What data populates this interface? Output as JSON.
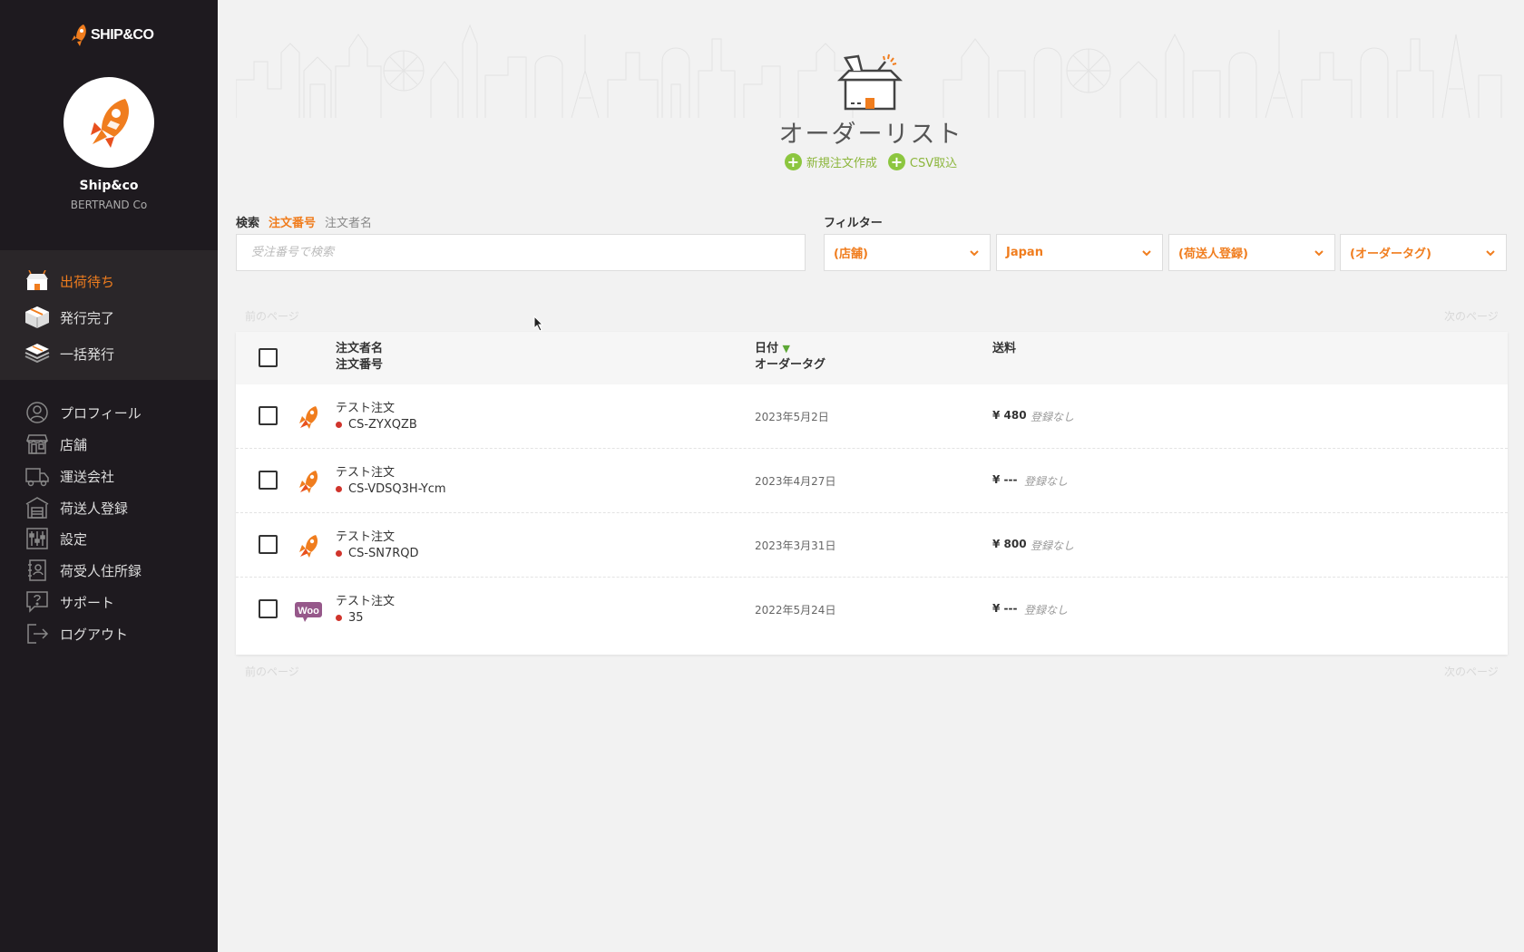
{
  "brand": {
    "logo_text": "SHIP&CO",
    "accent": "#f07d1e"
  },
  "account": {
    "name": "Ship&co",
    "company": "BERTRAND Co"
  },
  "sidebar": {
    "primary": [
      {
        "label": "出荷待ち",
        "icon": "store-box-icon",
        "active": true
      },
      {
        "label": "発行完了",
        "icon": "package-icon",
        "active": false
      },
      {
        "label": "一括発行",
        "icon": "stack-icon",
        "active": false
      }
    ],
    "secondary": [
      {
        "label": "プロフィール",
        "icon": "profile-icon"
      },
      {
        "label": "店舗",
        "icon": "shop-icon"
      },
      {
        "label": "運送会社",
        "icon": "truck-icon"
      },
      {
        "label": "荷送人登録",
        "icon": "warehouse-icon"
      },
      {
        "label": "設定",
        "icon": "sliders-icon"
      },
      {
        "label": "荷受人住所録",
        "icon": "address-book-icon"
      },
      {
        "label": "サポート",
        "icon": "help-icon"
      },
      {
        "label": "ログアウト",
        "icon": "logout-icon"
      }
    ]
  },
  "header": {
    "title": "オーダーリスト",
    "actions": [
      {
        "label": "新規注文作成",
        "icon": "plus-circle-icon"
      },
      {
        "label": "CSV取込",
        "icon": "plus-circle-icon"
      }
    ]
  },
  "search": {
    "label": "検索",
    "options": [
      "注文番号",
      "注文者名"
    ],
    "active_option": "注文番号",
    "placeholder": "受注番号で検索",
    "value": ""
  },
  "filters": {
    "label": "フィルター",
    "selects": [
      {
        "value": "(店舗)"
      },
      {
        "value": "Japan"
      },
      {
        "value": "(荷送人登録)"
      },
      {
        "value": "(オーダータグ)"
      }
    ]
  },
  "pagination": {
    "prev": "前のページ",
    "next": "次のページ"
  },
  "table": {
    "headers": {
      "col1_line1": "注文者名",
      "col1_line2": "注文番号",
      "col2_line1": "日付",
      "col2_sort": "▼",
      "col2_line2": "オーダータグ",
      "col3": "送料"
    },
    "rows": [
      {
        "store": "shipandco-rocket-icon",
        "name": "テスト注文",
        "number": "CS-ZYXQZB",
        "date": "2023年5月2日",
        "fee": "¥ 480",
        "tag_status": "登録なし"
      },
      {
        "store": "shipandco-rocket-icon",
        "name": "テスト注文",
        "number": "CS-VDSQ3H-Ycm",
        "date": "2023年4月27日",
        "fee": "¥ ---",
        "tag_status": "登録なし"
      },
      {
        "store": "shipandco-rocket-icon",
        "name": "テスト注文",
        "number": "CS-SN7RQD",
        "date": "2023年3月31日",
        "fee": "¥ 800",
        "tag_status": "登録なし"
      },
      {
        "store": "woocommerce-icon",
        "store_logo_text": "Woo",
        "name": "テスト注文",
        "number": "35",
        "date": "2022年5月24日",
        "fee": "¥ ---",
        "tag_status": "登録なし"
      }
    ]
  }
}
